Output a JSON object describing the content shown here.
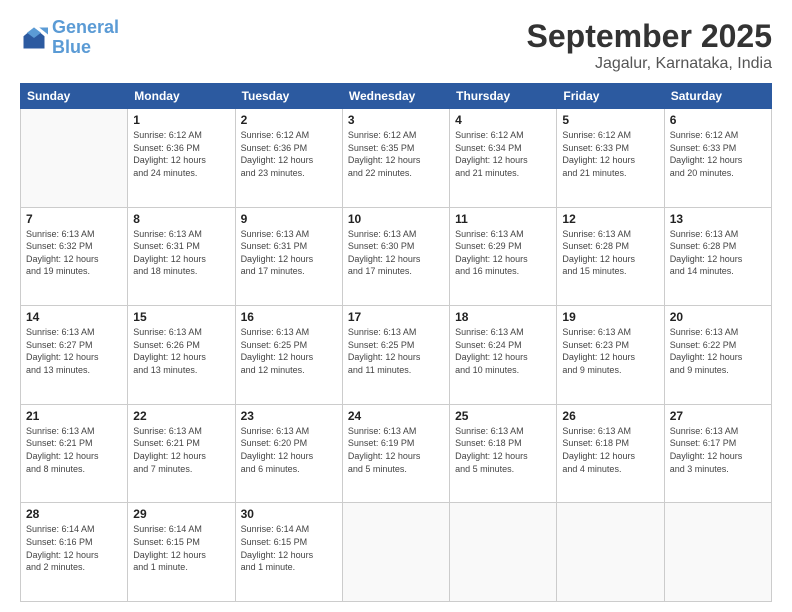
{
  "logo": {
    "line1": "General",
    "line2": "Blue"
  },
  "title": "September 2025",
  "subtitle": "Jagalur, Karnataka, India",
  "weekdays": [
    "Sunday",
    "Monday",
    "Tuesday",
    "Wednesday",
    "Thursday",
    "Friday",
    "Saturday"
  ],
  "weeks": [
    [
      {
        "day": "",
        "info": ""
      },
      {
        "day": "1",
        "info": "Sunrise: 6:12 AM\nSunset: 6:36 PM\nDaylight: 12 hours\nand 24 minutes."
      },
      {
        "day": "2",
        "info": "Sunrise: 6:12 AM\nSunset: 6:36 PM\nDaylight: 12 hours\nand 23 minutes."
      },
      {
        "day": "3",
        "info": "Sunrise: 6:12 AM\nSunset: 6:35 PM\nDaylight: 12 hours\nand 22 minutes."
      },
      {
        "day": "4",
        "info": "Sunrise: 6:12 AM\nSunset: 6:34 PM\nDaylight: 12 hours\nand 21 minutes."
      },
      {
        "day": "5",
        "info": "Sunrise: 6:12 AM\nSunset: 6:33 PM\nDaylight: 12 hours\nand 21 minutes."
      },
      {
        "day": "6",
        "info": "Sunrise: 6:12 AM\nSunset: 6:33 PM\nDaylight: 12 hours\nand 20 minutes."
      }
    ],
    [
      {
        "day": "7",
        "info": "Sunrise: 6:13 AM\nSunset: 6:32 PM\nDaylight: 12 hours\nand 19 minutes."
      },
      {
        "day": "8",
        "info": "Sunrise: 6:13 AM\nSunset: 6:31 PM\nDaylight: 12 hours\nand 18 minutes."
      },
      {
        "day": "9",
        "info": "Sunrise: 6:13 AM\nSunset: 6:31 PM\nDaylight: 12 hours\nand 17 minutes."
      },
      {
        "day": "10",
        "info": "Sunrise: 6:13 AM\nSunset: 6:30 PM\nDaylight: 12 hours\nand 17 minutes."
      },
      {
        "day": "11",
        "info": "Sunrise: 6:13 AM\nSunset: 6:29 PM\nDaylight: 12 hours\nand 16 minutes."
      },
      {
        "day": "12",
        "info": "Sunrise: 6:13 AM\nSunset: 6:28 PM\nDaylight: 12 hours\nand 15 minutes."
      },
      {
        "day": "13",
        "info": "Sunrise: 6:13 AM\nSunset: 6:28 PM\nDaylight: 12 hours\nand 14 minutes."
      }
    ],
    [
      {
        "day": "14",
        "info": "Sunrise: 6:13 AM\nSunset: 6:27 PM\nDaylight: 12 hours\nand 13 minutes."
      },
      {
        "day": "15",
        "info": "Sunrise: 6:13 AM\nSunset: 6:26 PM\nDaylight: 12 hours\nand 13 minutes."
      },
      {
        "day": "16",
        "info": "Sunrise: 6:13 AM\nSunset: 6:25 PM\nDaylight: 12 hours\nand 12 minutes."
      },
      {
        "day": "17",
        "info": "Sunrise: 6:13 AM\nSunset: 6:25 PM\nDaylight: 12 hours\nand 11 minutes."
      },
      {
        "day": "18",
        "info": "Sunrise: 6:13 AM\nSunset: 6:24 PM\nDaylight: 12 hours\nand 10 minutes."
      },
      {
        "day": "19",
        "info": "Sunrise: 6:13 AM\nSunset: 6:23 PM\nDaylight: 12 hours\nand 9 minutes."
      },
      {
        "day": "20",
        "info": "Sunrise: 6:13 AM\nSunset: 6:22 PM\nDaylight: 12 hours\nand 9 minutes."
      }
    ],
    [
      {
        "day": "21",
        "info": "Sunrise: 6:13 AM\nSunset: 6:21 PM\nDaylight: 12 hours\nand 8 minutes."
      },
      {
        "day": "22",
        "info": "Sunrise: 6:13 AM\nSunset: 6:21 PM\nDaylight: 12 hours\nand 7 minutes."
      },
      {
        "day": "23",
        "info": "Sunrise: 6:13 AM\nSunset: 6:20 PM\nDaylight: 12 hours\nand 6 minutes."
      },
      {
        "day": "24",
        "info": "Sunrise: 6:13 AM\nSunset: 6:19 PM\nDaylight: 12 hours\nand 5 minutes."
      },
      {
        "day": "25",
        "info": "Sunrise: 6:13 AM\nSunset: 6:18 PM\nDaylight: 12 hours\nand 5 minutes."
      },
      {
        "day": "26",
        "info": "Sunrise: 6:13 AM\nSunset: 6:18 PM\nDaylight: 12 hours\nand 4 minutes."
      },
      {
        "day": "27",
        "info": "Sunrise: 6:13 AM\nSunset: 6:17 PM\nDaylight: 12 hours\nand 3 minutes."
      }
    ],
    [
      {
        "day": "28",
        "info": "Sunrise: 6:14 AM\nSunset: 6:16 PM\nDaylight: 12 hours\nand 2 minutes."
      },
      {
        "day": "29",
        "info": "Sunrise: 6:14 AM\nSunset: 6:15 PM\nDaylight: 12 hours\nand 1 minute."
      },
      {
        "day": "30",
        "info": "Sunrise: 6:14 AM\nSunset: 6:15 PM\nDaylight: 12 hours\nand 1 minute."
      },
      {
        "day": "",
        "info": ""
      },
      {
        "day": "",
        "info": ""
      },
      {
        "day": "",
        "info": ""
      },
      {
        "day": "",
        "info": ""
      }
    ]
  ]
}
